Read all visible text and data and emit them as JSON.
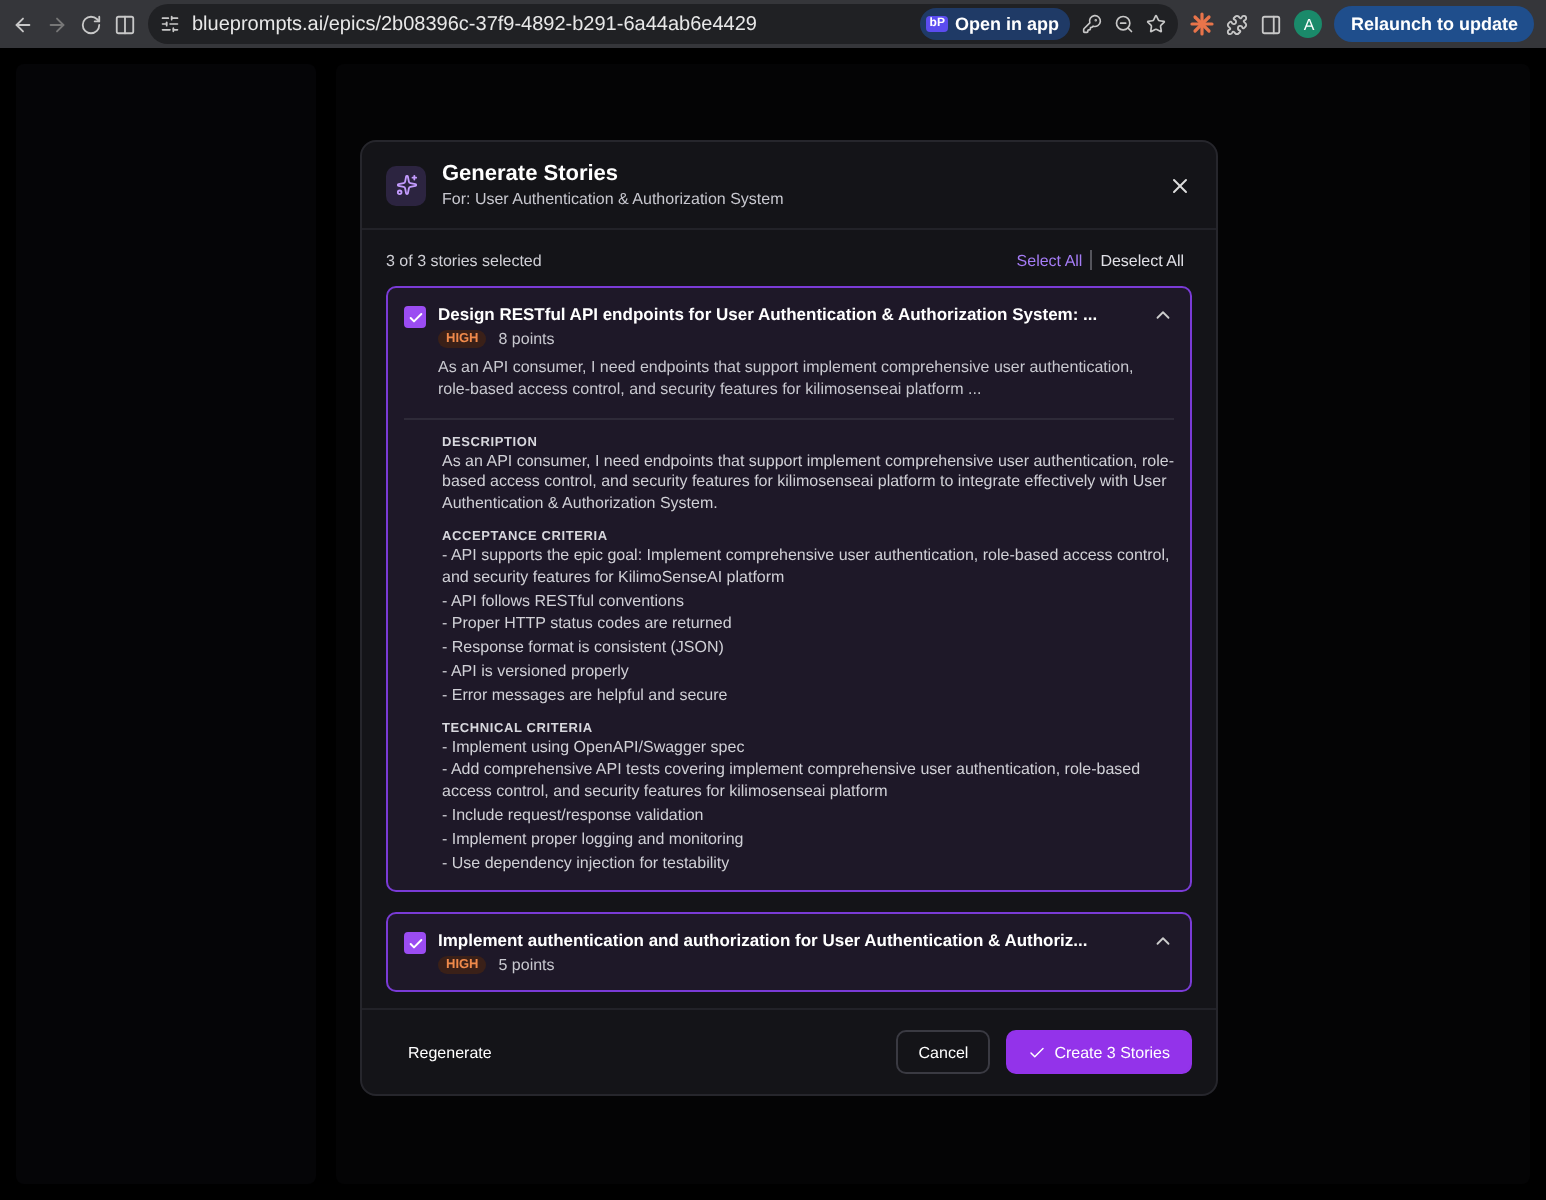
{
  "browser": {
    "url": "blueprompts.ai/epics/2b08396c-37f9-4892-b291-6a44ab6e4429",
    "app_badge": "bP",
    "open_in_app": "Open in app",
    "profile_initial": "A",
    "relaunch": "Relaunch to update"
  },
  "dialog": {
    "title": "Generate Stories",
    "subtitle": "For: User Authentication & Authorization System",
    "selection_count": "3 of 3 stories selected",
    "select_all": "Select All",
    "deselect_all": "Deselect All",
    "stories": [
      {
        "title": "Design RESTful API endpoints for User Authentication & Authorization System: ...",
        "checked": true,
        "priority": "HIGH",
        "points": "8 points",
        "summary": "As an API consumer, I need endpoints that support implement comprehensive user authentication, role-based access control, and security features for kilimosenseai platform ...",
        "sections": [
          {
            "heading": "DESCRIPTION",
            "kind": "paragraph",
            "text": "As an API consumer, I need endpoints that support implement comprehensive user authentication, role-based access control, and security features for kilimosenseai platform to integrate effectively with User Authentication & Authorization System."
          },
          {
            "heading": "ACCEPTANCE CRITERIA",
            "kind": "list",
            "items": [
              "- API supports the epic goal: Implement comprehensive user authentication, role-based access control, and security features for KilimoSenseAI platform",
              "- API follows RESTful conventions",
              "- Proper HTTP status codes are returned",
              "- Response format is consistent (JSON)",
              "- API is versioned properly",
              "- Error messages are helpful and secure"
            ]
          },
          {
            "heading": "TECHNICAL CRITERIA",
            "kind": "list",
            "items": [
              "- Implement using OpenAPI/Swagger spec",
              "- Add comprehensive API tests covering implement comprehensive user authentication, role-based access control, and security features for kilimosenseai platform",
              "- Include request/response validation",
              "- Implement proper logging and monitoring",
              "- Use dependency injection for testability"
            ]
          }
        ]
      },
      {
        "title": "Implement authentication and authorization for User Authentication & Authoriz...",
        "checked": true,
        "priority": "HIGH",
        "points": "5 points"
      }
    ],
    "buttons": {
      "regenerate": "Regenerate",
      "cancel": "Cancel",
      "create": "Create 3 Stories"
    }
  }
}
